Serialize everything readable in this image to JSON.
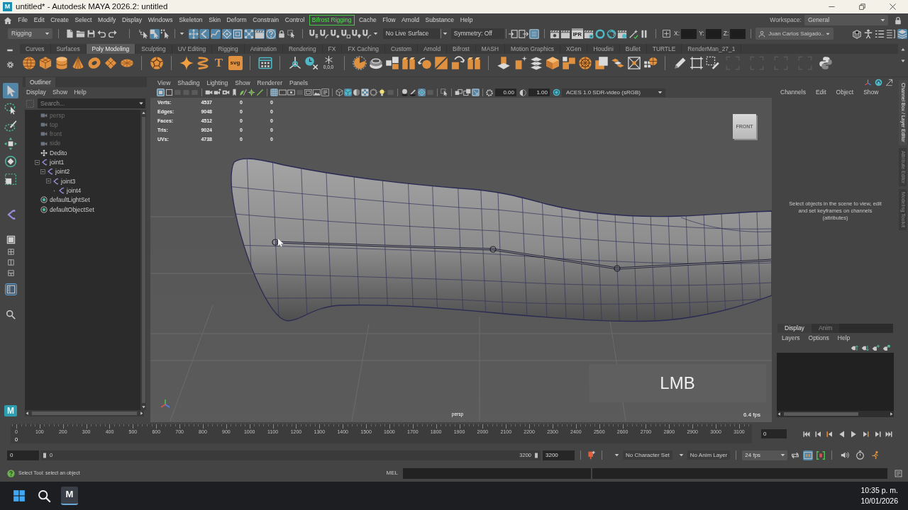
{
  "window": {
    "app_icon": "M",
    "title": "untitled* - Autodesk MAYA 2026.2: untitled"
  },
  "menu_bar": {
    "items": [
      {
        "label": "File",
        "highlighted": false
      },
      {
        "label": "Edit",
        "highlighted": false
      },
      {
        "label": "Create",
        "highlighted": false
      },
      {
        "label": "Select",
        "highlighted": false
      },
      {
        "label": "Modify",
        "highlighted": false
      },
      {
        "label": "Display",
        "highlighted": false
      },
      {
        "label": "Windows",
        "highlighted": false
      },
      {
        "label": "Skeleton",
        "highlighted": false
      },
      {
        "label": "Skin",
        "highlighted": false
      },
      {
        "label": "Deform",
        "highlighted": false
      },
      {
        "label": "Constrain",
        "highlighted": false
      },
      {
        "label": "Control",
        "highlighted": false
      },
      {
        "label": "Bifrost Rigging",
        "highlighted": true
      },
      {
        "label": "Cache",
        "highlighted": false
      },
      {
        "label": "Flow",
        "highlighted": false
      },
      {
        "label": "Arnold",
        "highlighted": false
      },
      {
        "label": "Substance",
        "highlighted": false
      },
      {
        "label": "Help",
        "highlighted": false
      }
    ],
    "workspace_label": "Workspace:",
    "workspace": "General"
  },
  "status_line": {
    "menu_set": "Rigging",
    "select_modes": [
      {
        "on": false
      },
      {
        "on": true
      },
      {
        "on": false
      }
    ],
    "pick_masks": [
      {
        "on": true
      },
      {
        "on": true
      },
      {
        "on": true
      },
      {
        "on": true
      },
      {
        "on": true
      },
      {
        "on": true
      },
      {
        "on": true
      },
      {
        "on": true
      }
    ],
    "live_surface": "No Live Surface",
    "symmetry": "Symmetry: Off",
    "editor_toggles": [
      {
        "on": false
      },
      {
        "on": false
      },
      {
        "on": true
      }
    ],
    "render_badge": "IPR",
    "coordinates": [
      "X:",
      "Y:",
      "Z:"
    ],
    "user": "Juan Carlos Salgado..",
    "panel_toggles": [
      {
        "on": false
      },
      {
        "on": false
      },
      {
        "on": false
      },
      {
        "on": false
      },
      {
        "on": true
      }
    ]
  },
  "shelf": {
    "tabs": [
      {
        "label": "Curves",
        "selected": false
      },
      {
        "label": "Surfaces",
        "selected": false
      },
      {
        "label": "Poly Modeling",
        "selected": true
      },
      {
        "label": "Sculpting",
        "selected": false
      },
      {
        "label": "UV Editing",
        "selected": false
      },
      {
        "label": "Rigging",
        "selected": false
      },
      {
        "label": "Animation",
        "selected": false
      },
      {
        "label": "Rendering",
        "selected": false
      },
      {
        "label": "FX",
        "selected": false
      },
      {
        "label": "FX Caching",
        "selected": false
      },
      {
        "label": "Custom",
        "selected": false
      },
      {
        "label": "Arnold",
        "selected": false
      },
      {
        "label": "Bifrost",
        "selected": false
      },
      {
        "label": "MASH",
        "selected": false
      },
      {
        "label": "Motion Graphics",
        "selected": false
      },
      {
        "label": "XGen",
        "selected": false
      },
      {
        "label": "Houdini",
        "selected": false
      },
      {
        "label": "Bullet",
        "selected": false
      },
      {
        "label": "TURTLE",
        "selected": false
      },
      {
        "label": "RenderMan_27_1",
        "selected": false
      }
    ],
    "text_buttons": [
      "T",
      "svg"
    ],
    "snap_readout": "0,0,0"
  },
  "toolbox": {
    "tools": [
      {
        "selected": true
      },
      {
        "selected": false
      },
      {
        "selected": false
      },
      {
        "selected": false
      },
      {
        "selected": false
      },
      {
        "selected": false
      }
    ],
    "layouts": [
      {
        "selected": false
      },
      {
        "selected": false
      },
      {
        "selected": false
      },
      {
        "selected": false
      },
      {
        "selected": true
      }
    ],
    "logo": "M"
  },
  "outliner": {
    "tab": "Outliner",
    "menu": [
      "Display",
      "Show",
      "Help"
    ],
    "search": {
      "placeholder": "Search..."
    },
    "items": [
      {
        "label": "persp",
        "kind": "camera",
        "dimmed": true
      },
      {
        "label": "top",
        "kind": "camera",
        "dimmed": true
      },
      {
        "label": "front",
        "kind": "camera",
        "dimmed": true
      },
      {
        "label": "side",
        "kind": "camera",
        "dimmed": true
      },
      {
        "label": "Dedito",
        "kind": "transform",
        "dimmed": false
      },
      {
        "label": "joint1",
        "kind": "joint",
        "dimmed": false,
        "expanded": true,
        "children": [
          {
            "label": "joint2",
            "kind": "joint",
            "dimmed": false,
            "expanded": true,
            "children": [
              {
                "label": "joint3",
                "kind": "joint",
                "dimmed": false,
                "expanded": true,
                "children": [
                  {
                    "label": "joint4",
                    "kind": "joint",
                    "dimmed": false
                  }
                ]
              }
            ]
          }
        ]
      },
      {
        "label": "defaultLightSet",
        "kind": "set",
        "dimmed": false
      },
      {
        "label": "defaultObjectSet",
        "kind": "set",
        "dimmed": false
      }
    ]
  },
  "viewport": {
    "menu": [
      "View",
      "Shading",
      "Lighting",
      "Show",
      "Renderer",
      "Panels"
    ],
    "toolbar_toggles": [
      {
        "on": true
      },
      {
        "on": false
      },
      {
        "on": false
      },
      {
        "on": false
      },
      {
        "on": false
      },
      {
        "on": false
      },
      {
        "on": false
      },
      {
        "on": false
      },
      {
        "on": false
      },
      {
        "on": false
      },
      {
        "on": false
      },
      {
        "on": false
      },
      {
        "on": true
      },
      {
        "on": false
      },
      {
        "on": false
      },
      {
        "on": false
      },
      {
        "on": false
      },
      {
        "on": false
      },
      {
        "on": false
      },
      {
        "on": false
      },
      {
        "on": true
      },
      {
        "on": false
      },
      {
        "on": true
      },
      {
        "on": false
      },
      {
        "on": false
      },
      {
        "on": false
      },
      {
        "on": false
      },
      {
        "on": false
      },
      {
        "on": true
      },
      {
        "on": false
      },
      {
        "on": false
      },
      {
        "on": false
      },
      {
        "on": false
      },
      {
        "on": true
      }
    ],
    "exposure": "0.00",
    "gamma": "1.00",
    "color_space": "ACES 1.0 SDR-video (sRGB)",
    "hud": [
      {
        "label": "Verts:",
        "values": [
          "4537",
          "0",
          "0"
        ]
      },
      {
        "label": "Edges:",
        "values": [
          "9048",
          "0",
          "0"
        ]
      },
      {
        "label": "Faces:",
        "values": [
          "4512",
          "0",
          "0"
        ]
      },
      {
        "label": "Tris:",
        "values": [
          "9024",
          "0",
          "0"
        ]
      },
      {
        "label": "UVs:",
        "values": [
          "4738",
          "0",
          "0"
        ]
      }
    ],
    "view_cube": "FRONT",
    "camera": "persp",
    "fps": "6.4 fps",
    "mouse_overlay": "LMB"
  },
  "channel_box": {
    "menu": [
      "Channels",
      "Edit",
      "Object",
      "Show"
    ],
    "message": "Select objects in the scene to view, edit and set keyframes on channels (attributes)"
  },
  "layer_editor": {
    "tabs": [
      {
        "label": "Display",
        "selected": true
      },
      {
        "label": "Anim",
        "selected": false
      }
    ],
    "menu": [
      "Layers",
      "Options",
      "Help"
    ]
  },
  "side_tabs": [
    {
      "label": "Channel Box / Layer Editor",
      "selected": true
    },
    {
      "label": "Attribute Editor",
      "selected": false
    },
    {
      "label": "Modeling Toolkit",
      "selected": false
    }
  ],
  "time_slider": {
    "ticks": [
      "0",
      "100",
      "200",
      "300",
      "400",
      "500",
      "600",
      "700",
      "800",
      "900",
      "1000",
      "1100",
      "1200",
      "1300",
      "1400",
      "1500",
      "1600",
      "1700",
      "1800",
      "1900",
      "2000",
      "2100",
      "2200",
      "2300",
      "2400",
      "2500",
      "2600",
      "2700",
      "2800",
      "2900",
      "3000",
      "3100"
    ],
    "current_frame_marker": "0",
    "current_frame": "0"
  },
  "range_slider": {
    "start_field": "0",
    "start": "0",
    "end": "3200",
    "end_field": "3200",
    "character_set": "No Character Set",
    "anim_layer": "No Anim Layer",
    "fps": "24 fps",
    "toggles": [
      {
        "on": false
      },
      {
        "on": true
      },
      {
        "on": false
      }
    ]
  },
  "help_line": {
    "message": "Select Tool: select an object",
    "command_language": "MEL"
  },
  "taskbar": {
    "apps": [
      {
        "kind": "start",
        "active": false
      },
      {
        "kind": "search",
        "active": false
      },
      {
        "kind": "maya",
        "label": "M",
        "active": true
      }
    ],
    "time": "10:35 p. m.",
    "date": "10/01/2026"
  }
}
